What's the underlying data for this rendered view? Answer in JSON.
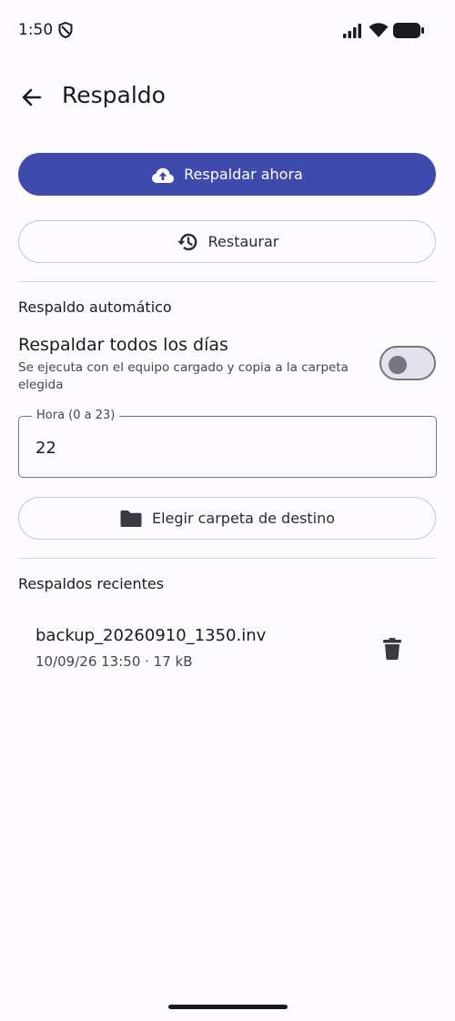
{
  "status_bar": {
    "time": "1:50"
  },
  "header": {
    "title": "Respaldo"
  },
  "actions": {
    "backup_now": "Respaldar ahora",
    "restore": "Restaurar"
  },
  "auto_backup": {
    "section_title": "Respaldo automático",
    "daily_label": "Respaldar todos los días",
    "daily_description": "Se ejecuta con el equipo cargado y copia a la carpeta elegida",
    "daily_enabled": false,
    "hour_field": {
      "label": "Hora (0 a 23)",
      "value": "22"
    },
    "choose_folder": "Elegir carpeta de destino"
  },
  "recent": {
    "section_title": "Respaldos recientes",
    "items": [
      {
        "name": "backup_20260910_1350.inv",
        "meta": "10/09/26 13:50 · 17 kB"
      }
    ]
  },
  "colors": {
    "primary": "#3f4aad",
    "background": "#fdfbff"
  }
}
